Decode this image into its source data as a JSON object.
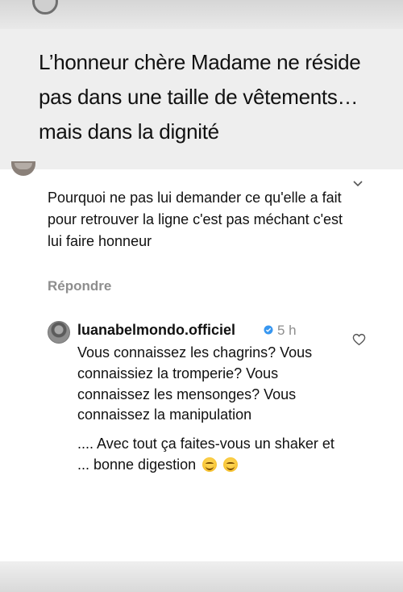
{
  "story": {
    "quote": "L’honneur chère Madame ne réside pas dans une taille de vêtements… mais dans la  dignité"
  },
  "comment": {
    "text": "Pourquoi ne pas lui demander ce qu'elle a fait pour retrouver la ligne c'est pas méchant c'est lui faire honneur",
    "reply_label": "Répondre",
    "menu_icon": "chevron-down-icon"
  },
  "reply": {
    "username": "luanabelmondo.officiel",
    "verified_icon": "verified-badge-icon",
    "time": "5 h",
    "paragraph1": "Vous connaissez les chagrins? Vous connaissiez la tromperie? Vous connaissez les mensonges? Vous connaissez la manipulation",
    "paragraph2": ".... Avec tout ça faites-vous un shaker et ... bonne digestion",
    "emoji": "smiling-face-emoji",
    "like_icon": "heart-icon"
  },
  "colors": {
    "background": "#ececec",
    "card": "#ffffff",
    "text": "#111111",
    "secondary_text": "#8e8e8e",
    "verified": "#3897f0"
  }
}
